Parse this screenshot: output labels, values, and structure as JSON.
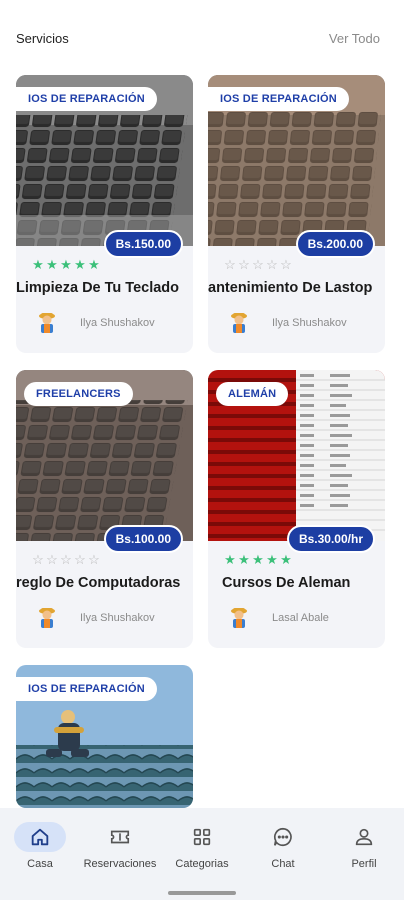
{
  "header": {
    "title": "Servicios",
    "see_all": "Ver Todo"
  },
  "cards": [
    {
      "category": "IOS DE REPARACIÓN",
      "price": "Bs.150.00",
      "rating": 5,
      "name": "Limpieza De Tu Teclado",
      "author": "Ilya Shushakov"
    },
    {
      "category": "IOS DE REPARACIÓN",
      "price": "Bs.200.00",
      "rating": 0,
      "name": "antenimiento De Lastop",
      "author": "Ilya Shushakov"
    },
    {
      "category": "FREELANCERS",
      "price": "Bs.100.00",
      "rating": 0,
      "name": "reglo De Computadoras",
      "author": "Ilya Shushakov"
    },
    {
      "category": "ALEMÁN",
      "price": "Bs.30.00/hr",
      "rating": 5,
      "name": "Cursos De Aleman",
      "author": "Lasal Abale"
    },
    {
      "category": "IOS DE REPARACIÓN"
    }
  ],
  "nav": {
    "items": [
      {
        "label": "Casa",
        "icon": "home-icon",
        "active": true
      },
      {
        "label": "Reservaciones",
        "icon": "ticket-icon",
        "active": false
      },
      {
        "label": "Categorias",
        "icon": "grid-icon",
        "active": false
      },
      {
        "label": "Chat",
        "icon": "chat-icon",
        "active": false
      },
      {
        "label": "Perfil",
        "icon": "user-icon",
        "active": false
      }
    ]
  },
  "colors": {
    "accent": "#1d3ea3",
    "star_on": "#3cc07a",
    "star_off": "#b8b8b8",
    "nav_bg": "#f1f3f7",
    "nav_active": "#d6e2f8"
  }
}
